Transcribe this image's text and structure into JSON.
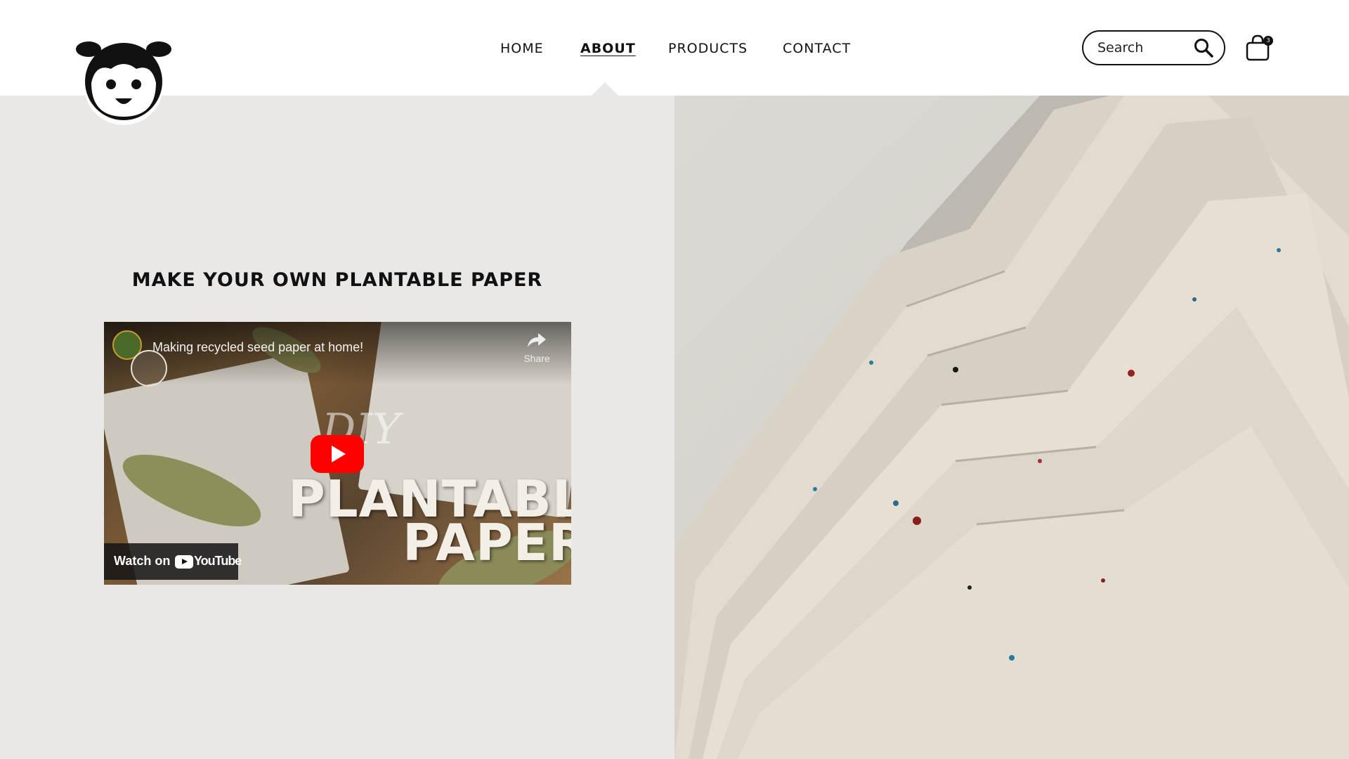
{
  "header": {
    "nav": [
      {
        "label": "HOME",
        "active": false
      },
      {
        "label": "ABOUT",
        "active": true
      },
      {
        "label": "PRODUCTS",
        "active": false
      },
      {
        "label": "CONTACT",
        "active": false
      }
    ],
    "search": {
      "placeholder": "Search"
    },
    "cart": {
      "count": "3"
    },
    "logo_icon": "girl-face-logo",
    "search_icon": "magnifier-icon",
    "cart_icon": "shopping-bag-icon"
  },
  "main": {
    "title": "MAKE YOUR OWN PLANTABLE PAPER",
    "video": {
      "title": "Making recycled seed paper at home!",
      "share_label": "Share",
      "overlay_cursive": "DIY",
      "overlay_line1": "PLANTABLE",
      "overlay_line2": "PAPER",
      "watch_label": "Watch on",
      "platform": "YouTube"
    }
  },
  "colors": {
    "panel_background": "#e9e8e6",
    "text": "#111111",
    "youtube_red": "#ff0000"
  }
}
